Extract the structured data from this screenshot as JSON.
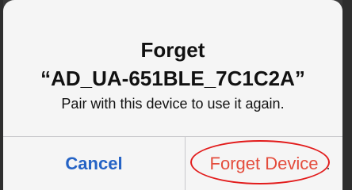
{
  "dialog": {
    "title": "Forget",
    "device_name": "“AD_UA-651BLE_7C1C2A”",
    "message": "Pair with this device to use it again.",
    "buttons": {
      "cancel": "Cancel",
      "forget": "Forget Device"
    }
  },
  "colors": {
    "dialog_bg": "#f5f5f5",
    "cancel_text": "#2563c5",
    "forget_text": "#e44c3c",
    "annotation_circle": "#e21b1b"
  }
}
